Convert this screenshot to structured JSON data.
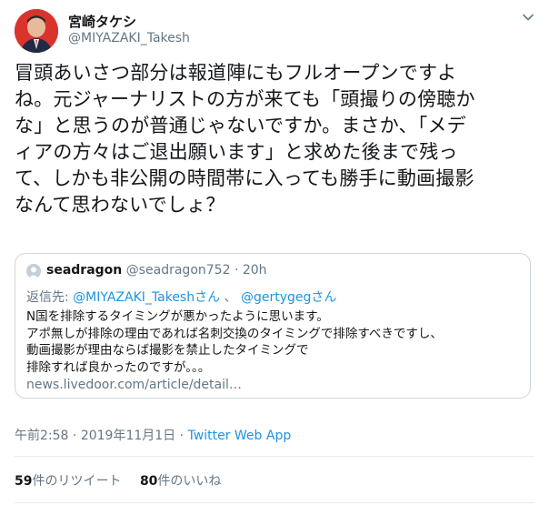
{
  "author": {
    "display_name": "宮崎タケシ",
    "handle": "@MIYAZAKI_Takesh"
  },
  "tweet": {
    "lines": [
      "冒頭あいさつ部分は報道陣にもフルオープンですよ",
      "ね。元ジャーナリストの方が来ても「頭撮りの傍聴か",
      "な」と思うのが普通じゃないですか。まさか、「メデ",
      "ィアの方々はご退出願います」と求めた後まで残っ",
      "て、しかも非公開の時間帯に入っても勝手に動画撮影",
      "なんて思わないでしょ？"
    ]
  },
  "quoted": {
    "display_name": "seadragon",
    "handle": "@seadragon752",
    "separator": "·",
    "age": "20h",
    "reply_prefix": "返信先: ",
    "reply_to_1": "@MIYAZAKI_Takeshさん",
    "reply_sep": " 、 ",
    "reply_to_2": "@gertygegさん",
    "lines": [
      "N国を排除するタイミングが悪かったように思います。",
      "アポ無しが排除の理由であれば名刺交換のタイミングで排除すべきですし、",
      "動画撮影が理由ならば撮影を禁止したタイミングで",
      "排除すれば良かったのですが。。。"
    ],
    "link": "news.livedoor.com/article/detail…"
  },
  "meta": {
    "time": "午前2:58",
    "separator": " · ",
    "date": "2019年11月1日",
    "source": "Twitter Web App"
  },
  "stats": {
    "retweets_count": "59",
    "retweets_label": "件のリツイート",
    "likes_count": "80",
    "likes_label": "件のいいね"
  },
  "icons": {
    "menu": "chevron-down-icon"
  },
  "colors": {
    "link": "#1b95e0",
    "secondary_text": "#657786",
    "border": "#ccd6dd"
  }
}
